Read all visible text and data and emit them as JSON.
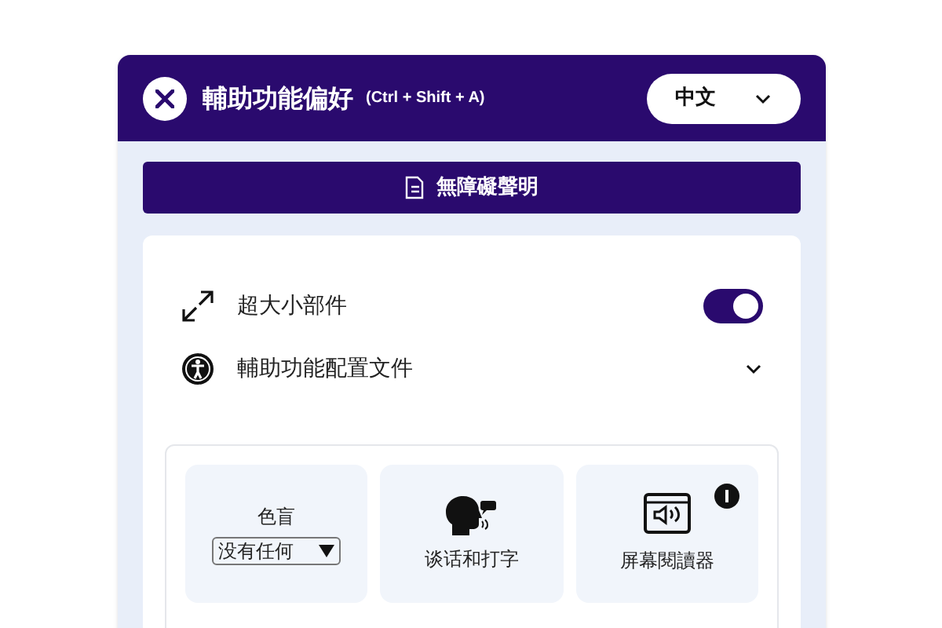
{
  "header": {
    "title": "輔助功能偏好",
    "shortcut": "(Ctrl + Shift + A)",
    "language": "中文"
  },
  "statement_button": "無障礙聲明",
  "settings": [
    {
      "kind": "toggle",
      "label": "超大小部件",
      "on": true
    },
    {
      "kind": "expand",
      "label": "輔助功能配置文件",
      "expanded": false
    }
  ],
  "tiles": [
    {
      "kind": "select",
      "title": "色盲",
      "value": "没有任何"
    },
    {
      "kind": "speech",
      "label": "谈话和打字",
      "info": false
    },
    {
      "kind": "reader",
      "label": "屏幕閱讀器",
      "info": true
    }
  ]
}
